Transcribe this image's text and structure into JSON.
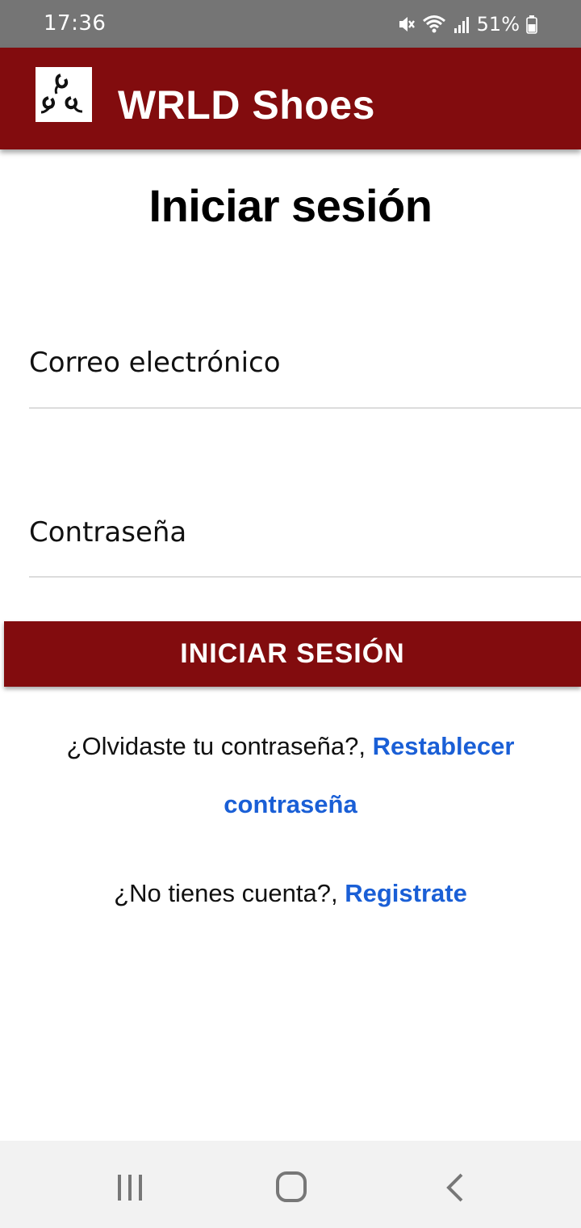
{
  "status_bar": {
    "time": "17:36",
    "battery": "51%",
    "icons": [
      "mute-icon",
      "wifi-icon",
      "signal-icon",
      "battery-icon"
    ]
  },
  "app_bar": {
    "title": "WRLD Shoes",
    "logo_icon": "logo-icon",
    "background_color": "#820c0e"
  },
  "main": {
    "title": "Iniciar sesión",
    "email_placeholder": "Correo electrónico",
    "password_placeholder": "Contraseña",
    "login_button": "INICIAR SESIÓN",
    "forgot_text": "¿Olvidaste tu contraseña?,",
    "forgot_link": "Restablecer contraseña",
    "register_text": "¿No tienes cuenta?,",
    "register_link": "Registrate",
    "link_color": "#1a5fd6"
  },
  "nav_bar": {
    "icons": [
      "recents-icon",
      "home-icon",
      "back-icon"
    ]
  }
}
